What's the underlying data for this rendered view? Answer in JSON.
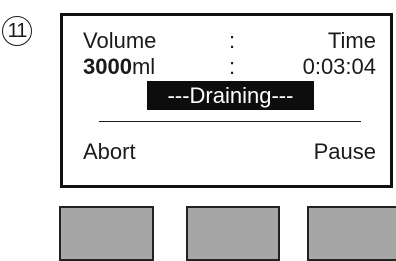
{
  "step": {
    "number": "11"
  },
  "display": {
    "volume_label": "Volume",
    "separator": ":",
    "time_label": "Time",
    "volume_value": "3000",
    "volume_unit": "ml",
    "time_value": "0:03:04",
    "status": "---Draining---",
    "softkeys": {
      "left": "Abort",
      "right": "Pause"
    }
  },
  "hardware_buttons": [
    {
      "id": "left"
    },
    {
      "id": "middle"
    },
    {
      "id": "right"
    }
  ],
  "colors": {
    "status_background": "#0d0d0d",
    "status_text": "#ffffff",
    "button_fill": "#a6a6a6",
    "border": "#111111"
  }
}
